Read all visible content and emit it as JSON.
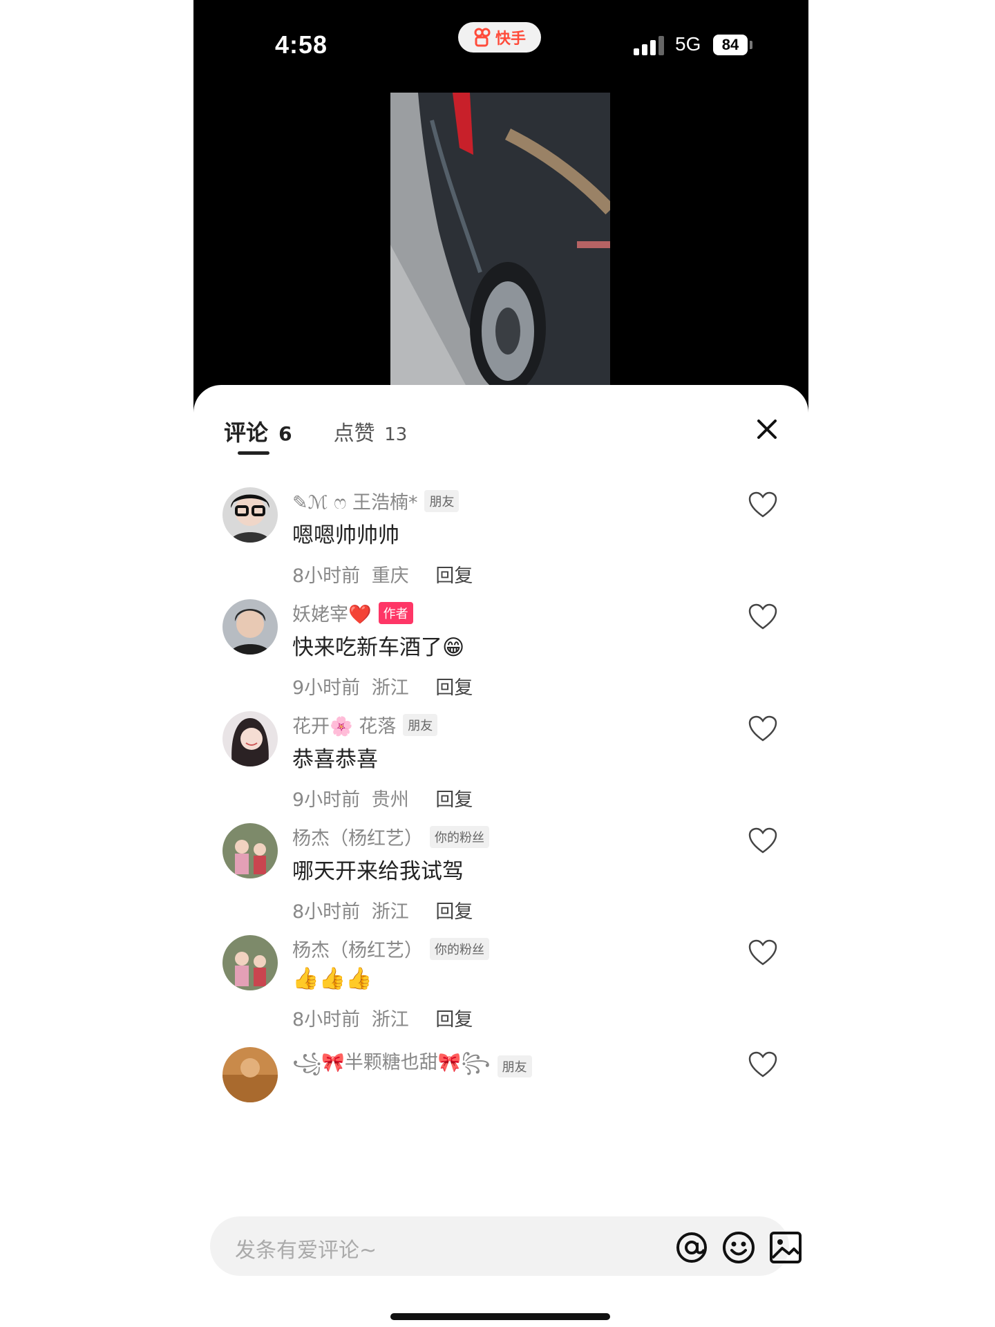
{
  "status_bar": {
    "time": "4:58",
    "app_name": "快手",
    "network": "5G",
    "battery": "84"
  },
  "sheet": {
    "tab_comments_label": "评论",
    "tab_comments_count": "6",
    "tab_likes_label": "点赞",
    "tab_likes_count": "13"
  },
  "comments": [
    {
      "username": "✎ℳ ෆ 王浩楠*",
      "badge": "朋友",
      "text": "嗯嗯帅帅帅",
      "time": "8小时前",
      "location": "重庆",
      "reply": "回复"
    },
    {
      "username": "妖姥宰❤️",
      "badge": "作者",
      "text": "快来吃新车酒了😁",
      "time": "9小时前",
      "location": "浙江",
      "reply": "回复"
    },
    {
      "username": "花开🌸 花落",
      "badge": "朋友",
      "text": "恭喜恭喜",
      "time": "9小时前",
      "location": "贵州",
      "reply": "回复"
    },
    {
      "username": "杨杰（杨红艺）",
      "badge": "你的粉丝",
      "text": "哪天开来给我试驾",
      "time": "8小时前",
      "location": "浙江",
      "reply": "回复"
    },
    {
      "username": "杨杰（杨红艺）",
      "badge": "你的粉丝",
      "text": "👍👍👍",
      "time": "8小时前",
      "location": "浙江",
      "reply": "回复"
    },
    {
      "username": "꧁🎀半颗糖也甜🎀꧂",
      "badge": "朋友"
    }
  ],
  "input": {
    "placeholder": "发条有爱评论~"
  },
  "icons": {
    "mention": "at-icon",
    "emoji": "emoji-icon",
    "image": "image-icon",
    "like": "heart-icon",
    "close": "close-icon"
  }
}
